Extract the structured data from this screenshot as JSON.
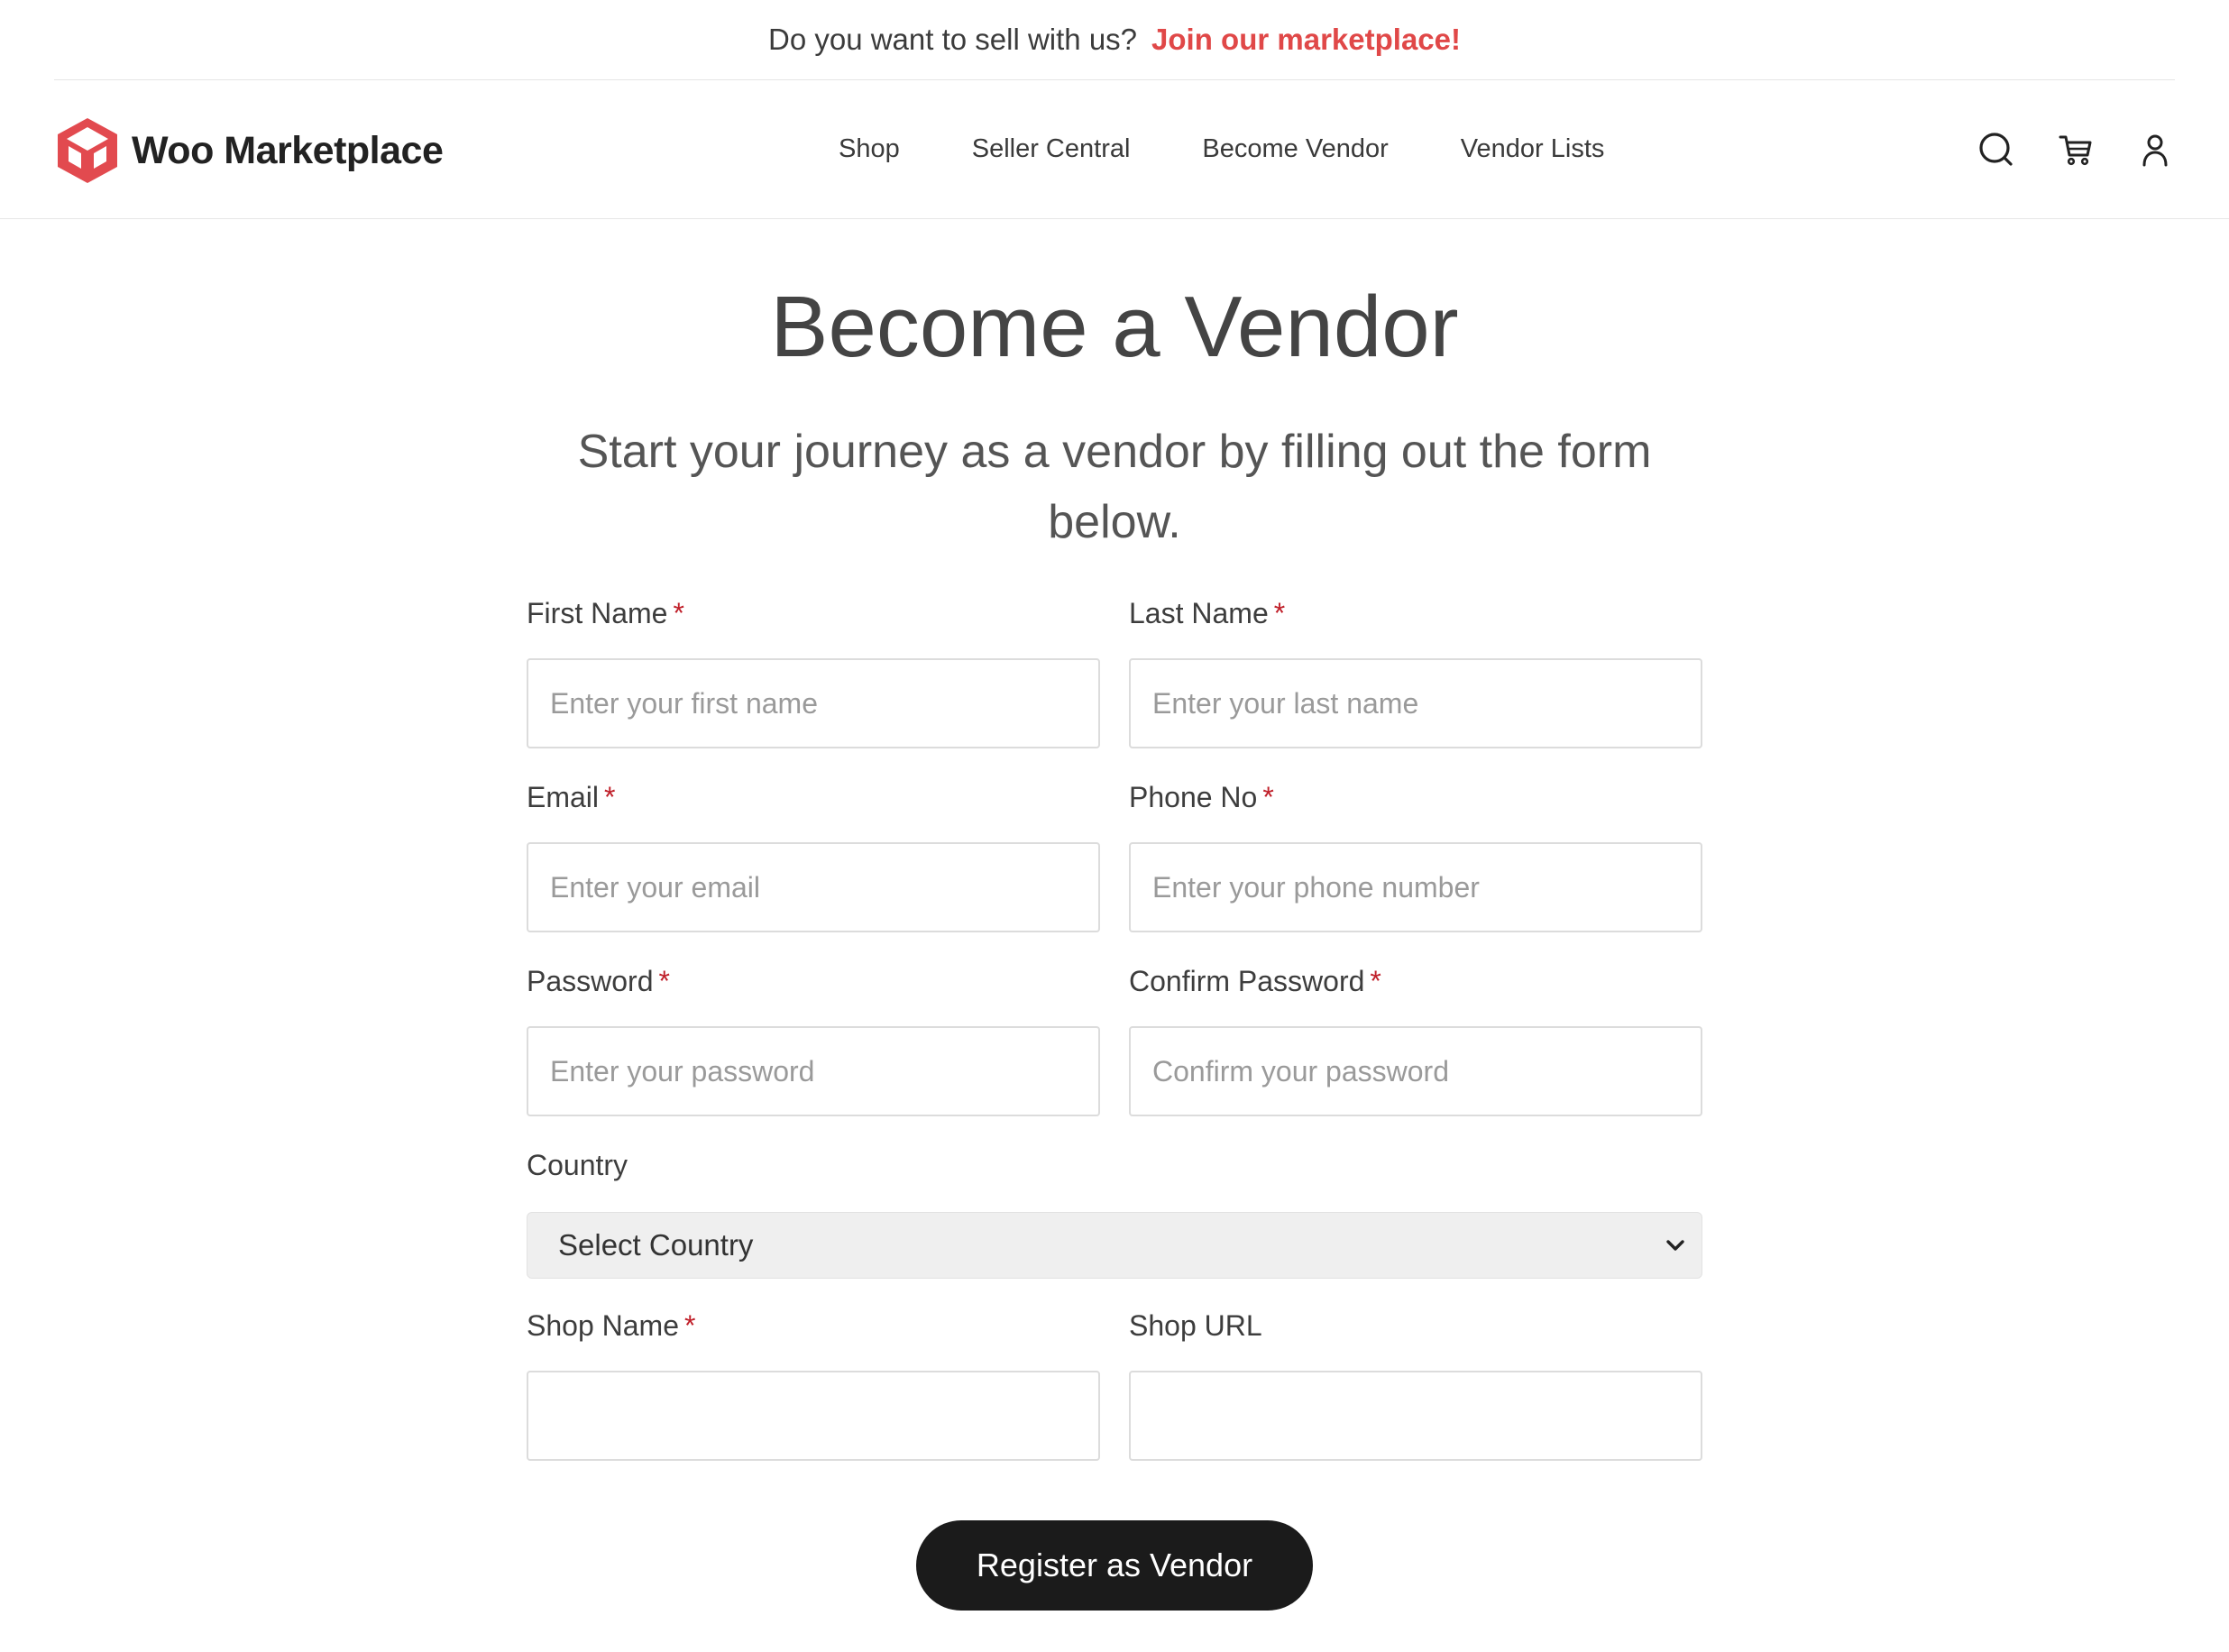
{
  "announcement": {
    "question": "Do you want to sell with us?",
    "cta": "Join our marketplace!"
  },
  "header": {
    "brand": "Woo Marketplace",
    "nav": [
      {
        "label": "Shop"
      },
      {
        "label": "Seller Central"
      },
      {
        "label": "Become Vendor"
      },
      {
        "label": "Vendor Lists"
      }
    ],
    "icons": [
      "search-icon",
      "cart-icon",
      "user-icon"
    ]
  },
  "main": {
    "title": "Become a Vendor",
    "subtitle": "Start your journey as a vendor by filling out the form below."
  },
  "form": {
    "required_mark": "*",
    "first_name": {
      "label": "First Name",
      "placeholder": "Enter your first name",
      "value": ""
    },
    "last_name": {
      "label": "Last Name",
      "placeholder": "Enter your last name",
      "value": ""
    },
    "email": {
      "label": "Email",
      "placeholder": "Enter your email",
      "value": ""
    },
    "phone": {
      "label": "Phone No",
      "placeholder": "Enter your phone number",
      "value": ""
    },
    "password": {
      "label": "Password",
      "placeholder": "Enter your password",
      "value": ""
    },
    "confirm_password": {
      "label": "Confirm Password",
      "placeholder": "Confirm your password",
      "value": ""
    },
    "country": {
      "label": "Country",
      "selected": "Select Country"
    },
    "shop_name": {
      "label": "Shop Name",
      "placeholder": "",
      "value": ""
    },
    "shop_url": {
      "label": "Shop URL",
      "placeholder": "",
      "value": ""
    },
    "submit_label": "Register as Vendor"
  },
  "colors": {
    "accent": "#e04848",
    "required": "#c0202a",
    "button": "#1b1b1b"
  }
}
